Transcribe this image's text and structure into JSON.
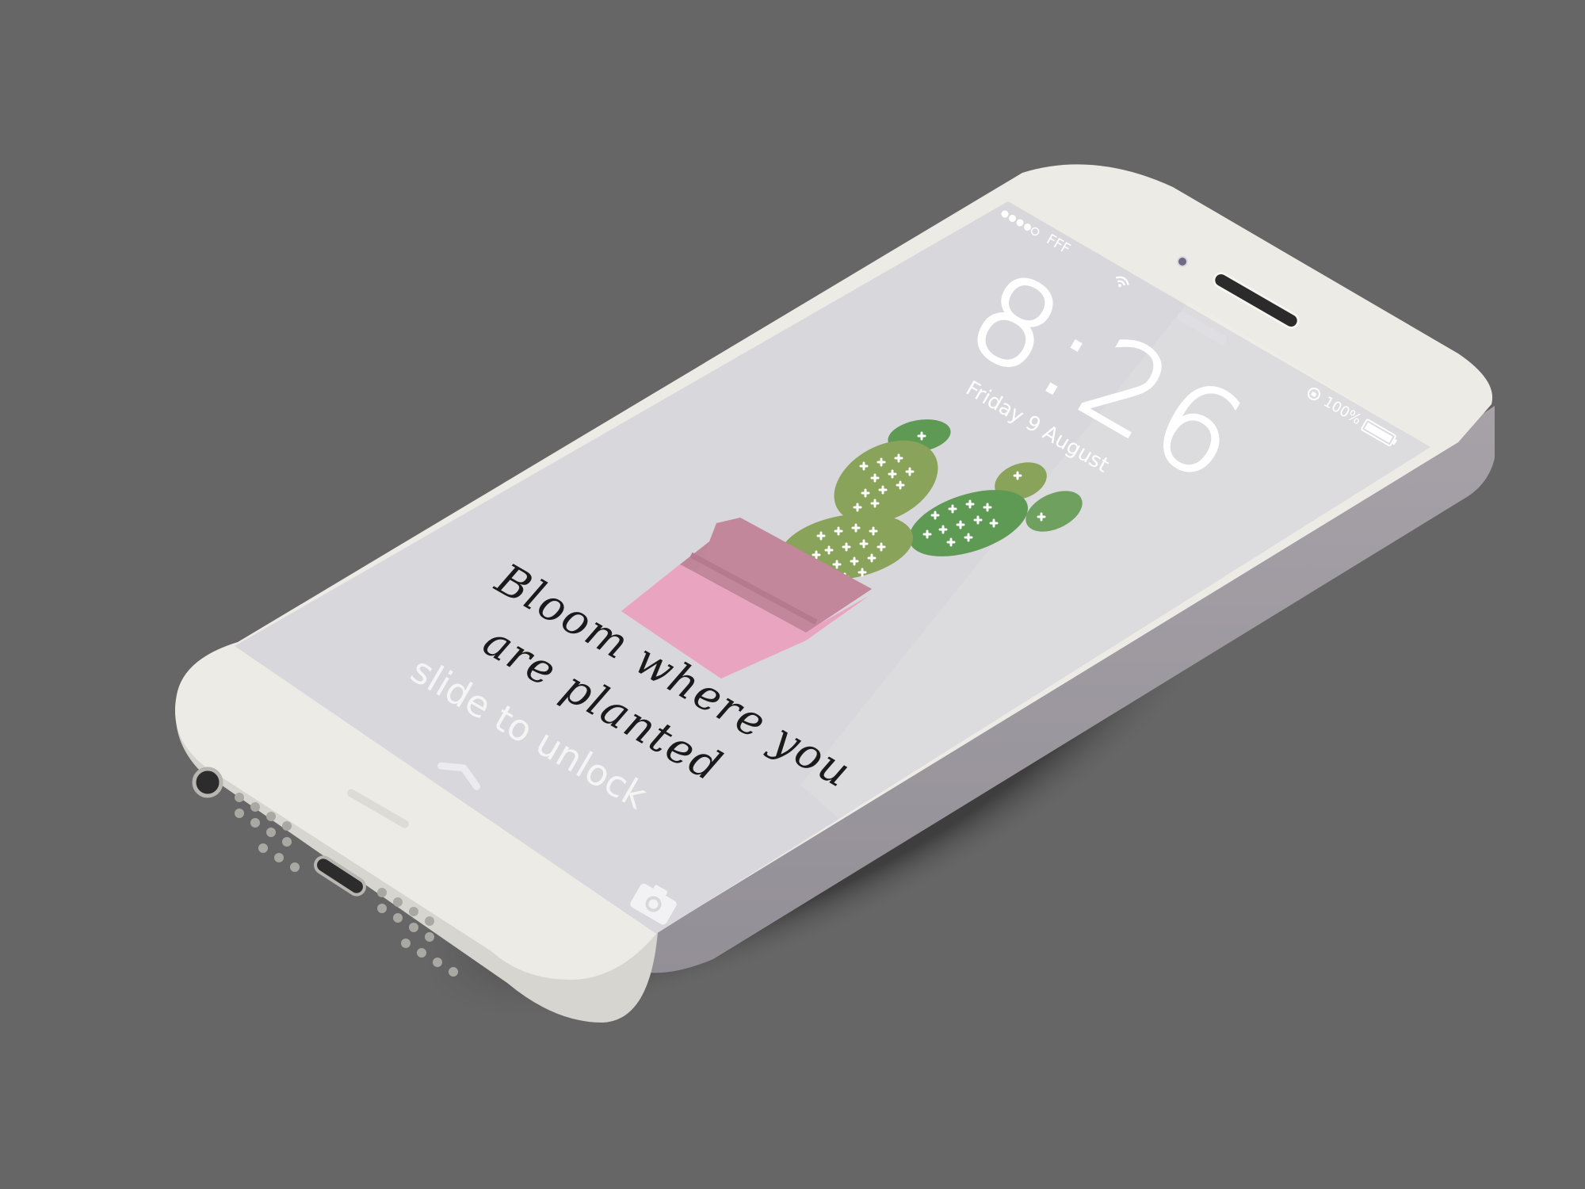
{
  "status_bar": {
    "carrier": "FFF",
    "signal_bars_filled": 4,
    "signal_bars_total": 5,
    "battery_percent": "100%",
    "wifi_icon": "wifi-icon",
    "lock_icon": "orientation-lock-icon",
    "battery_icon": "battery-icon"
  },
  "lock_screen": {
    "time": "8:26",
    "date": "Friday 9 August",
    "unlock_hint": "slide to unlock",
    "camera_icon": "camera-icon",
    "grabber_icon": "chevron-up-icon"
  },
  "wallpaper": {
    "quote_line1": "Bloom where you",
    "quote_line2": "are planted",
    "pot_color": "#e9a4bf",
    "pot_rim_color": "#c2879b",
    "cactus_color_light": "#8aa35a",
    "cactus_color_dark": "#5f9a55"
  },
  "device": {
    "body_color": "#ecebe6",
    "screen_color": "#d8d7db",
    "side_color": "#9e9aa0"
  }
}
